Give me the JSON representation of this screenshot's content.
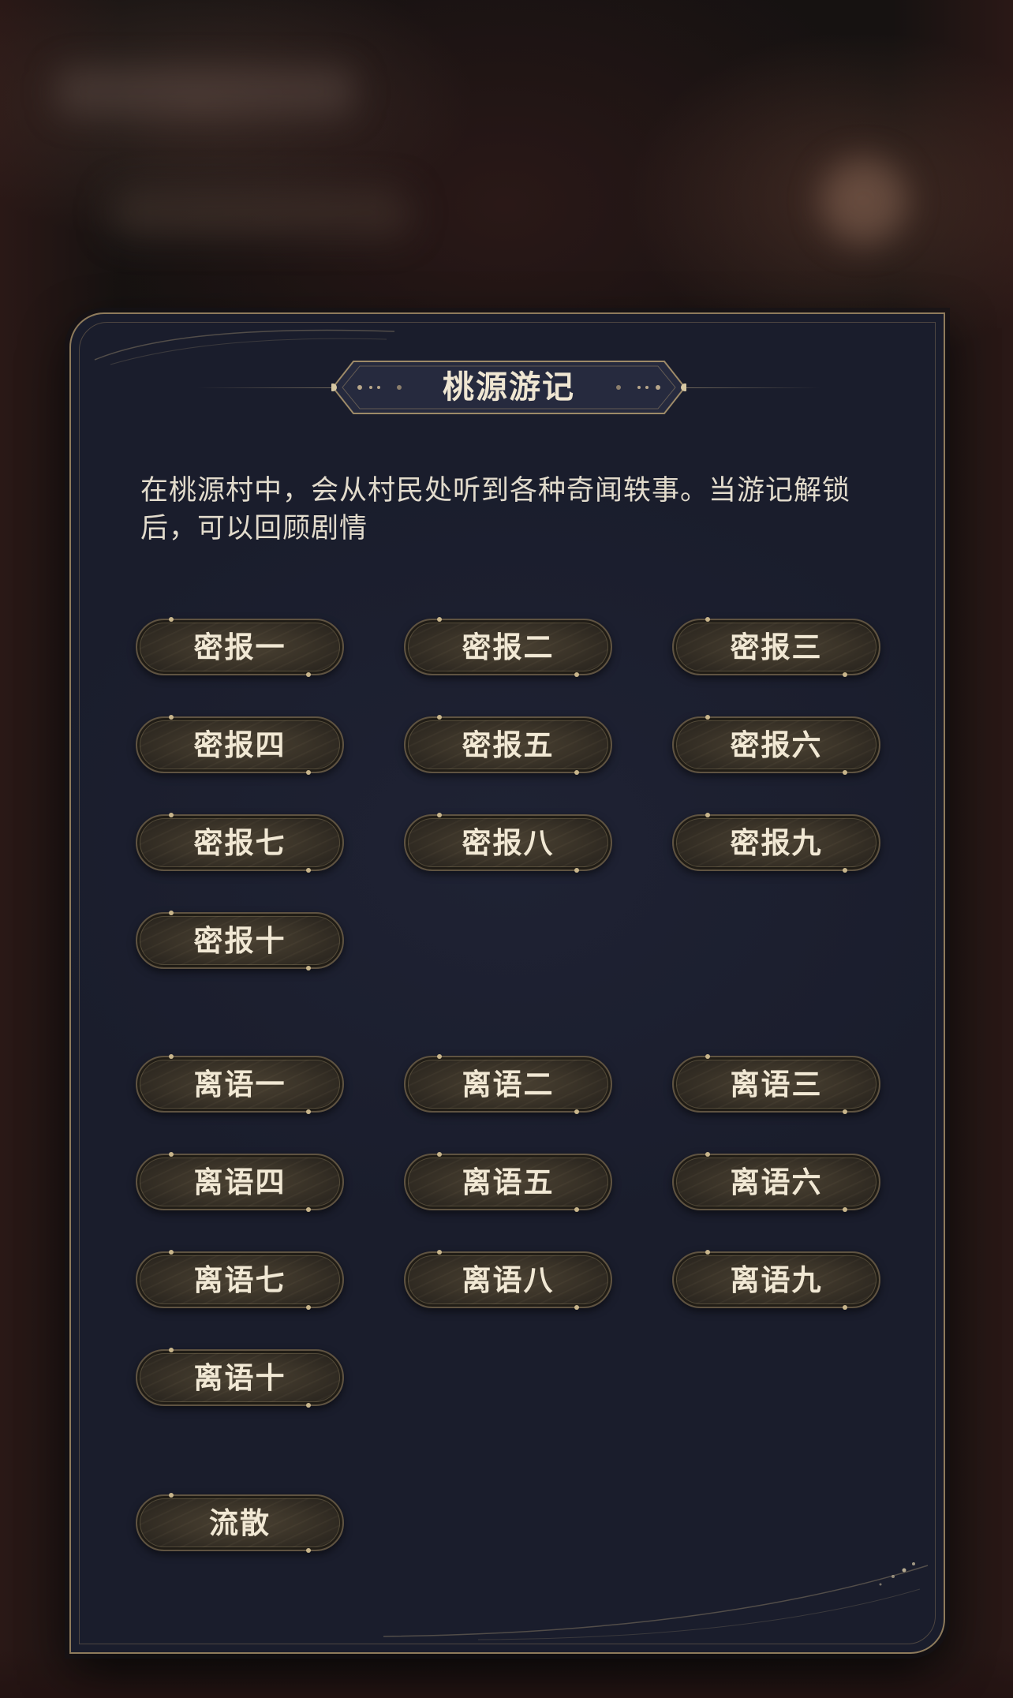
{
  "panel": {
    "title": "桃源游记",
    "description": "在桃源村中，会从村民处听到各种奇闻轶事。当游记解锁后，可以回顾剧情"
  },
  "groups": {
    "mibao": [
      "密报一",
      "密报二",
      "密报三",
      "密报四",
      "密报五",
      "密报六",
      "密报七",
      "密报八",
      "密报九",
      "密报十"
    ],
    "liyu": [
      "离语一",
      "离语二",
      "离语三",
      "离语四",
      "离语五",
      "离语六",
      "离语七",
      "离语八",
      "离语九",
      "离语十"
    ],
    "other": [
      "流散"
    ]
  },
  "colors": {
    "panel_bg": "#1a1d2c",
    "panel_border": "#8e7b5c",
    "button_bg": "#3a3328",
    "button_text": "#f1e8d4",
    "text": "#e2dbcc"
  }
}
